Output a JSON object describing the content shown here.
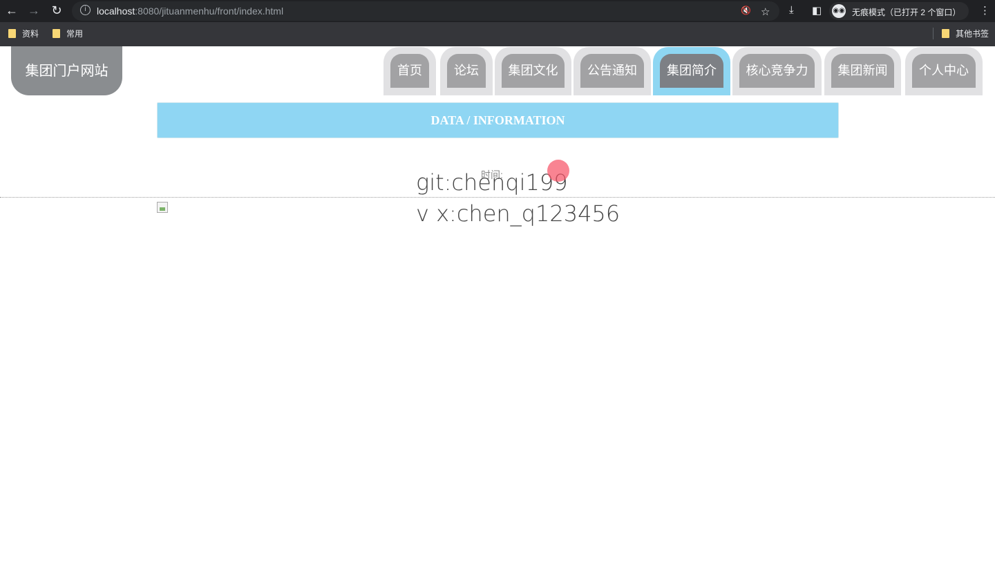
{
  "browser": {
    "url_host": "localhost",
    "url_rest": ":8080/jituanmenhu/front/index.html",
    "incognito_label": "无痕模式（已打开 2 个窗口）",
    "bookmarks": [
      "资料",
      "常用"
    ],
    "other_bookmarks": "其他书签"
  },
  "site": {
    "logo": "集团门户网站",
    "nav": [
      {
        "label": "首页",
        "active": false
      },
      {
        "label": "论坛",
        "active": false
      },
      {
        "label": "集团文化",
        "active": false
      },
      {
        "label": "公告通知",
        "active": false
      },
      {
        "label": "集团简介",
        "active": true
      },
      {
        "label": "核心竞争力",
        "active": false
      },
      {
        "label": "集团新闻",
        "active": false
      },
      {
        "label": "个人中心",
        "active": false
      }
    ],
    "banner": "DATA / INFORMATION",
    "time_label": "时间:",
    "line1": "git:chenqi199",
    "line2": "v x:chen_q123456"
  },
  "colors": {
    "accent": "#8fd6f3",
    "tab": "#a2a2a4",
    "logo": "#8a8d90"
  }
}
